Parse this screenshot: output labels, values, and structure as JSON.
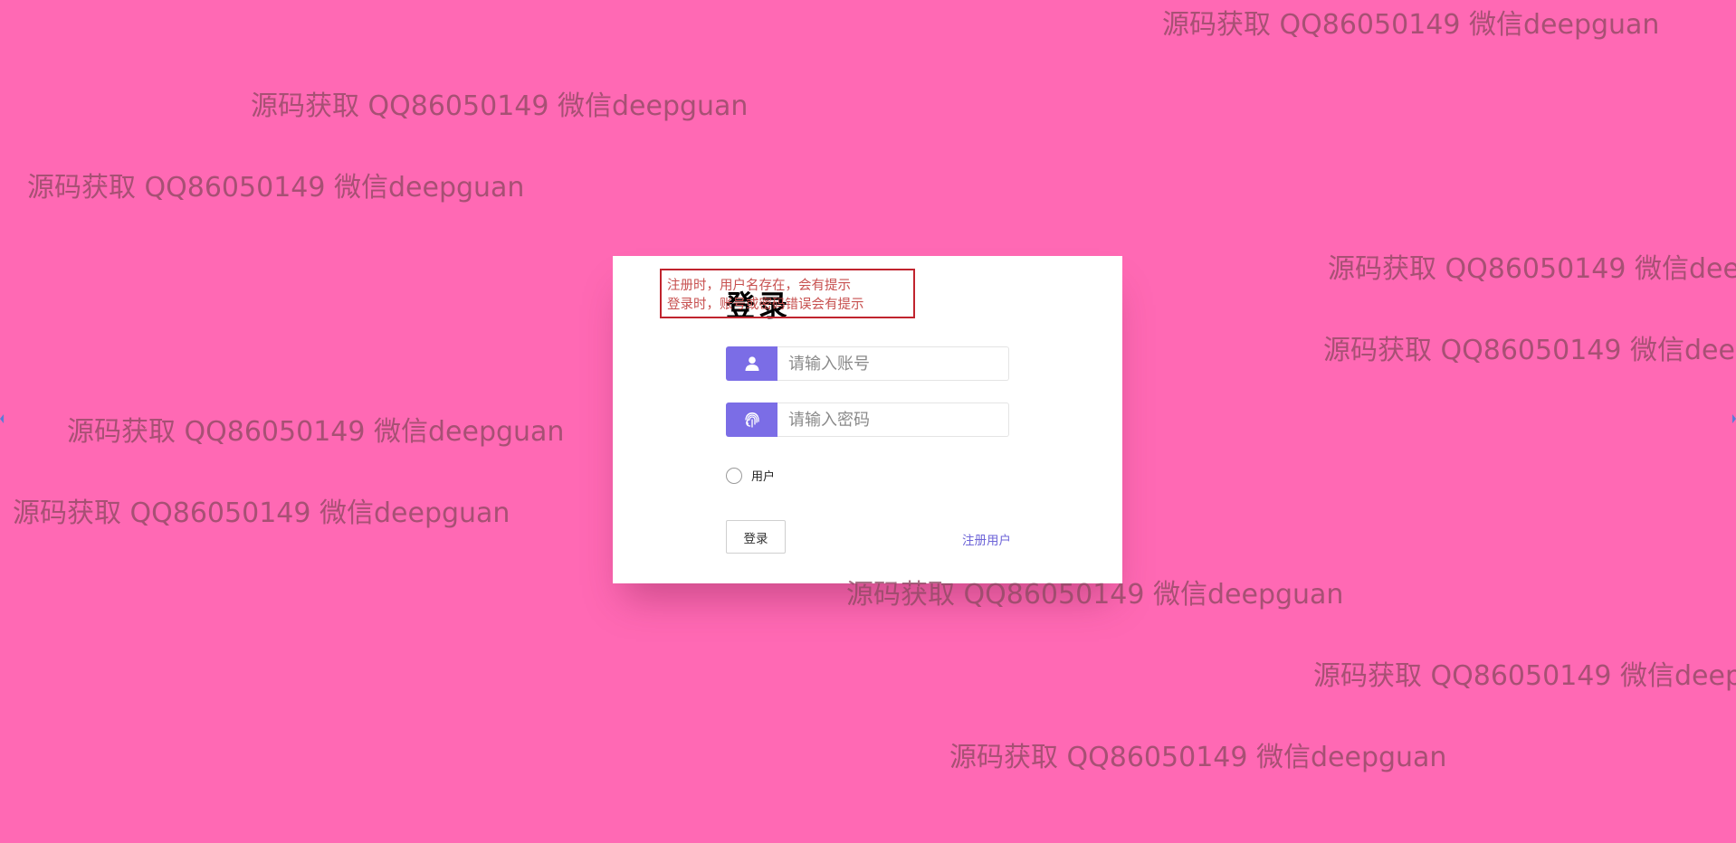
{
  "page": {
    "background_color": "#ff69b4",
    "watermark_text": "源码获取 QQ86050149 微信deepguan"
  },
  "login": {
    "title": "登录",
    "hint_lines": [
      "注册时，用户名存在，会有提示",
      "登录时，账号或密码错误会有提示"
    ],
    "username_placeholder": "请输入账号",
    "password_placeholder": "请输入密码",
    "role_label": "用户",
    "role_selected": false,
    "login_button_label": "登录",
    "register_link_label": "注册用户"
  },
  "icons": {
    "username": "user-icon",
    "password": "fingerprint-icon"
  },
  "colors": {
    "icon_background": "#7b6de6",
    "link": "#6f66d8",
    "hint_border": "#c0242e",
    "hint_text": "#c7504f"
  }
}
